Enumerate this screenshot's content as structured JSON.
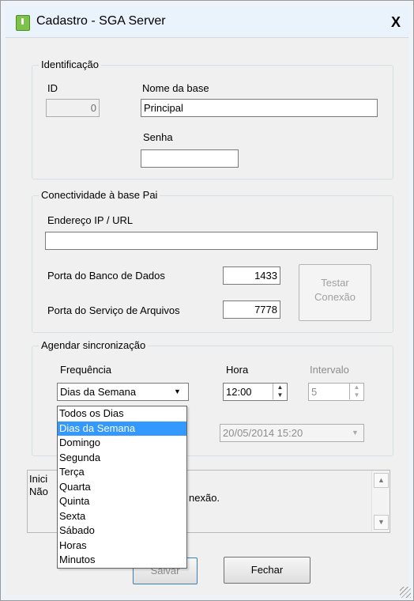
{
  "window": {
    "title": "Cadastro - SGA Server",
    "close_glyph": "X"
  },
  "identificacao": {
    "legend": "Identificação",
    "id_label": "ID",
    "id_value": "0",
    "nome_label": "Nome da base",
    "nome_value": "Principal",
    "senha_label": "Senha",
    "senha_value": ""
  },
  "conectividade": {
    "legend": "Conectividade à base Pai",
    "endereco_label": "Endereço IP / URL",
    "endereco_value": "",
    "porta_banco_label": "Porta do Banco de Dados",
    "porta_banco_value": "1433",
    "porta_arquivos_label": "Porta do Serviço de Arquivos",
    "porta_arquivos_value": "7778",
    "testar_line1": "Testar",
    "testar_line2": "Conexão"
  },
  "agendar": {
    "legend": "Agendar sincronização",
    "frequencia_label": "Frequência",
    "frequencia_value": "Dias da Semana",
    "hora_label": "Hora",
    "hora_value": "12:00",
    "intervalo_label": "Intervalo",
    "intervalo_value": "5",
    "data_value": "20/05/2014 15:20",
    "dropdown_options": [
      "Todos os Dias",
      "Dias da Semana",
      "Domingo",
      "Segunda",
      "Terça",
      "Quarta",
      "Quinta",
      "Sexta",
      "Sábado",
      "Horas",
      "Minutos"
    ],
    "dropdown_selected": "Dias da Semana"
  },
  "log": {
    "line1_visible": "Inici",
    "line2_visible_a": "Não",
    "line2_visible_b": "nexão."
  },
  "buttons": {
    "salvar": "Salvar",
    "fechar": "Fechar"
  },
  "colors": {
    "selection": "#3399ff",
    "title_icon": "#7ec24b"
  }
}
